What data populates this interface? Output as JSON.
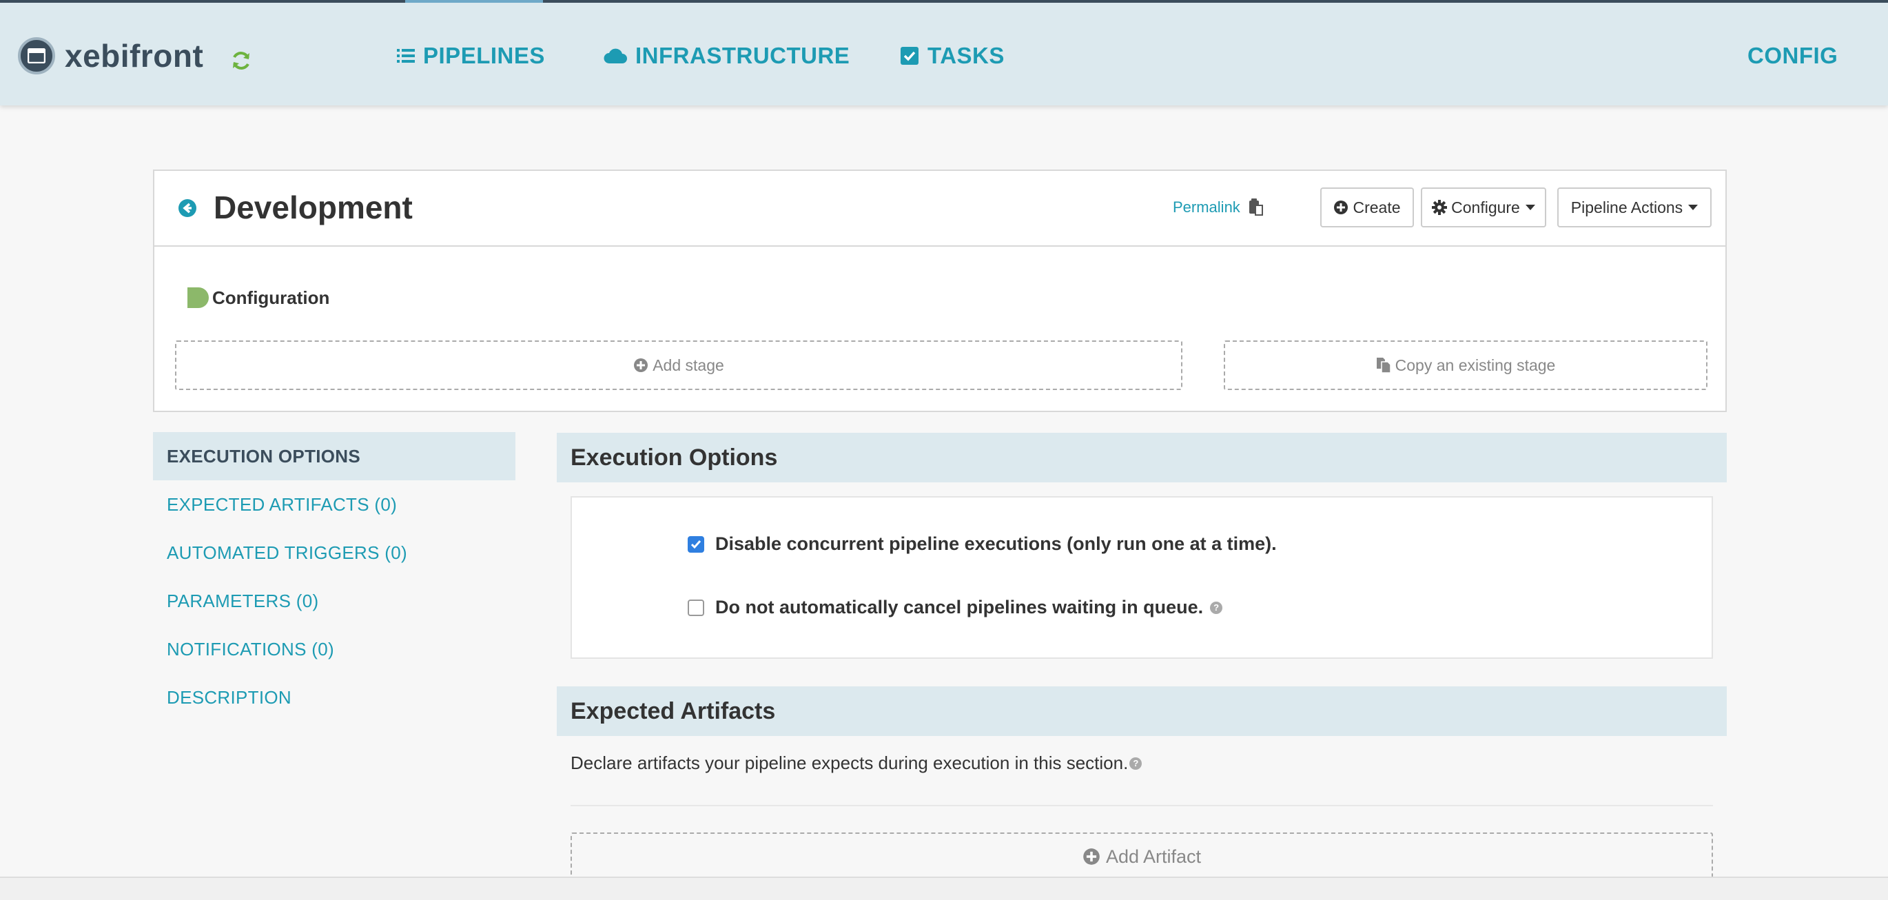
{
  "app": {
    "brand": "xebifront",
    "nav": [
      "PIPELINES",
      "INFRASTRUCTURE",
      "TASKS"
    ],
    "config": "CONFIG",
    "colors": {
      "accent": "#1d9bb3",
      "navBg": "#dce9ee",
      "brandDark": "#3b4d5c",
      "checkboxBlue": "#2f7fe0"
    }
  },
  "pipeline": {
    "title": "Development",
    "permalink": "Permalink",
    "buttons": {
      "create": "Create",
      "configure": "Configure",
      "actions": "Pipeline Actions"
    },
    "config_label": "Configuration",
    "add_stage": "Add stage",
    "copy_stage": "Copy an existing stage"
  },
  "side_menu": [
    "EXECUTION OPTIONS",
    "EXPECTED ARTIFACTS (0)",
    "AUTOMATED TRIGGERS (0)",
    "PARAMETERS (0)",
    "NOTIFICATIONS (0)",
    "DESCRIPTION"
  ],
  "side_menu_active": "EXECUTION OPTIONS",
  "execution": {
    "title": "Execution Options",
    "options": [
      {
        "label": "Disable concurrent pipeline executions (only run one at a time).",
        "checked": true
      },
      {
        "label": "Do not automatically cancel pipelines waiting in queue.",
        "checked": false
      }
    ]
  },
  "artifacts": {
    "title": "Expected Artifacts",
    "description": "Declare artifacts your pipeline expects during execution in this section.",
    "add": "Add Artifact"
  }
}
